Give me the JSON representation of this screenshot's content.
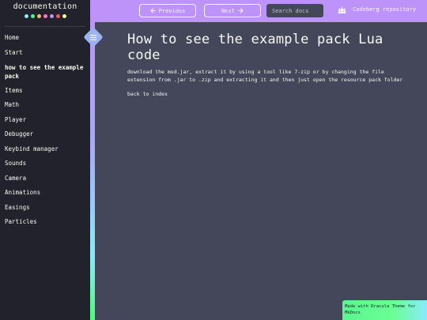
{
  "sidebar": {
    "title": "documentation",
    "dots": [
      "#8be9fd",
      "#50fa7b",
      "#ffb86c",
      "#ff79c6",
      "#bd93f9",
      "#ff5555",
      "#f1fa8c"
    ],
    "items": [
      {
        "label": "Home"
      },
      {
        "label": "Start"
      },
      {
        "label": "how to see the example pack",
        "active": true
      },
      {
        "label": "Items"
      },
      {
        "label": "Math"
      },
      {
        "label": "Player"
      },
      {
        "label": "Debugger"
      },
      {
        "label": "Keybind manager"
      },
      {
        "label": "Sounds"
      },
      {
        "label": "Camera"
      },
      {
        "label": "Animations"
      },
      {
        "label": "Easings"
      },
      {
        "label": "Particles"
      }
    ]
  },
  "header": {
    "prev_label": "Previous",
    "next_label": "Next",
    "search_placeholder": "Search docs",
    "repo_label": "Codeberg repository",
    "prev_icon": "arrow-left-icon",
    "next_icon": "arrow-right-icon",
    "repo_icon": "codeberg-logo-icon"
  },
  "toggle": {
    "icon": "hamburger-menu-icon"
  },
  "main": {
    "title": "How to see the example pack Lua code",
    "paragraph": "download the mod.jar, extract it by using a tool like 7-zip or by changing the file extension from .jar to .zip and extracting it and then just open the resource pack folder",
    "back_link": "back to index"
  },
  "footer": {
    "text": "Made with Dracula Theme for MkDocs"
  },
  "colors": {
    "background": "#44475a",
    "sidebar": "#21222c",
    "accent": "#bd93f9",
    "text": "#f8f8f2"
  }
}
